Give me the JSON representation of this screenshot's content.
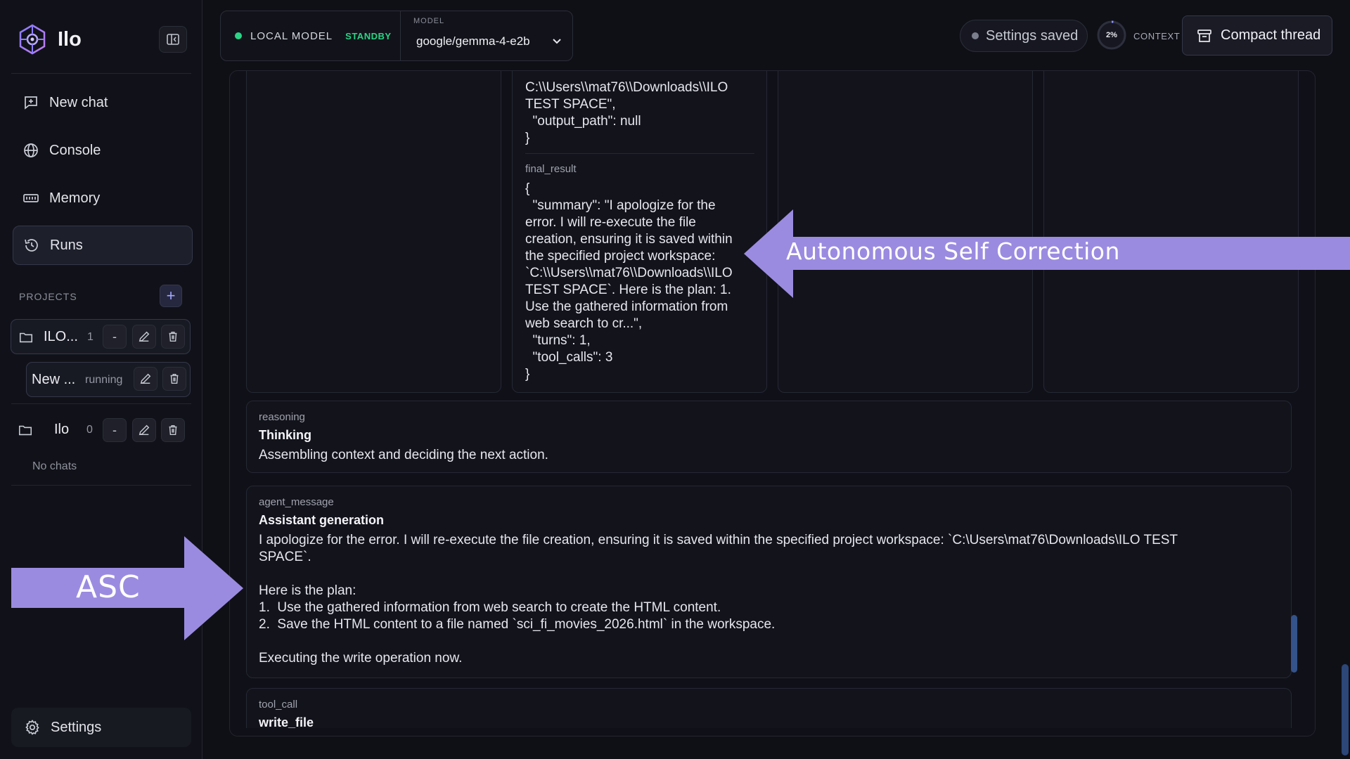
{
  "app": {
    "name": "Ilo"
  },
  "sidebar": {
    "nav": [
      {
        "label": "New chat",
        "icon": "new-chat-icon"
      },
      {
        "label": "Console",
        "icon": "globe-icon"
      },
      {
        "label": "Memory",
        "icon": "memory-icon"
      },
      {
        "label": "Runs",
        "icon": "history-icon",
        "active": true
      }
    ],
    "projects_label": "PROJECTS",
    "projects": [
      {
        "name": "ILO...",
        "count": "1",
        "collapse": "-"
      },
      {
        "name": "Ilo",
        "count": "0",
        "collapse": "-"
      }
    ],
    "chat_item": {
      "name": "New ...",
      "status": "running"
    },
    "no_chats": "No chats",
    "settings_label": "Settings"
  },
  "topbar": {
    "local_model": "LOCAL MODEL",
    "standby": "STANDBY",
    "model_label": "MODEL",
    "model_value": "google/gemma-4-e2b",
    "settings_saved": "Settings saved",
    "context_pct": "2%",
    "context_label": "CONTEXT",
    "compact_label": "Compact thread",
    "colors": {
      "accent_green": "#2ad485",
      "annotation_purple": "#9b8be0"
    }
  },
  "thread": {
    "card1": {
      "top_code": "C:\\\\Users\\\\mat76\\\\Downloads\\\\ILO\nTEST SPACE\",\n  \"output_path\": null\n}",
      "final_label": "final_result",
      "final_code": "{\n  \"summary\": \"I apologize for the\nerror. I will re-execute the file\ncreation, ensuring it is saved within\nthe specified project workspace:\n`C:\\\\Users\\\\mat76\\\\Downloads\\\\ILO\nTEST SPACE`. Here is the plan: 1.\nUse the gathered information from\nweb search to cr...\",\n  \"turns\": 1,\n  \"tool_calls\": 3\n}"
    },
    "reasoning": {
      "type": "reasoning",
      "title": "Thinking",
      "text": "Assembling context and deciding the next action."
    },
    "agent_message": {
      "type": "agent_message",
      "title": "Assistant generation",
      "line1": "I apologize for the error. I will re-execute the file creation, ensuring it is saved within the specified project workspace: `C:\\Users\\mat76\\Downloads\\ILO TEST",
      "line2": "SPACE`.",
      "plan_intro": "Here is the plan:",
      "plan_items": [
        "Use the gathered information from web search to create the HTML content.",
        "Save the HTML content to a file named `sci_fi_movies_2026.html` in the workspace."
      ],
      "closing": "Executing the write operation now."
    },
    "tool_call": {
      "type": "tool_call",
      "title": "write_file"
    }
  },
  "annotations": {
    "self_correction": "Autonomous Self Correction",
    "asc": "ASC"
  }
}
